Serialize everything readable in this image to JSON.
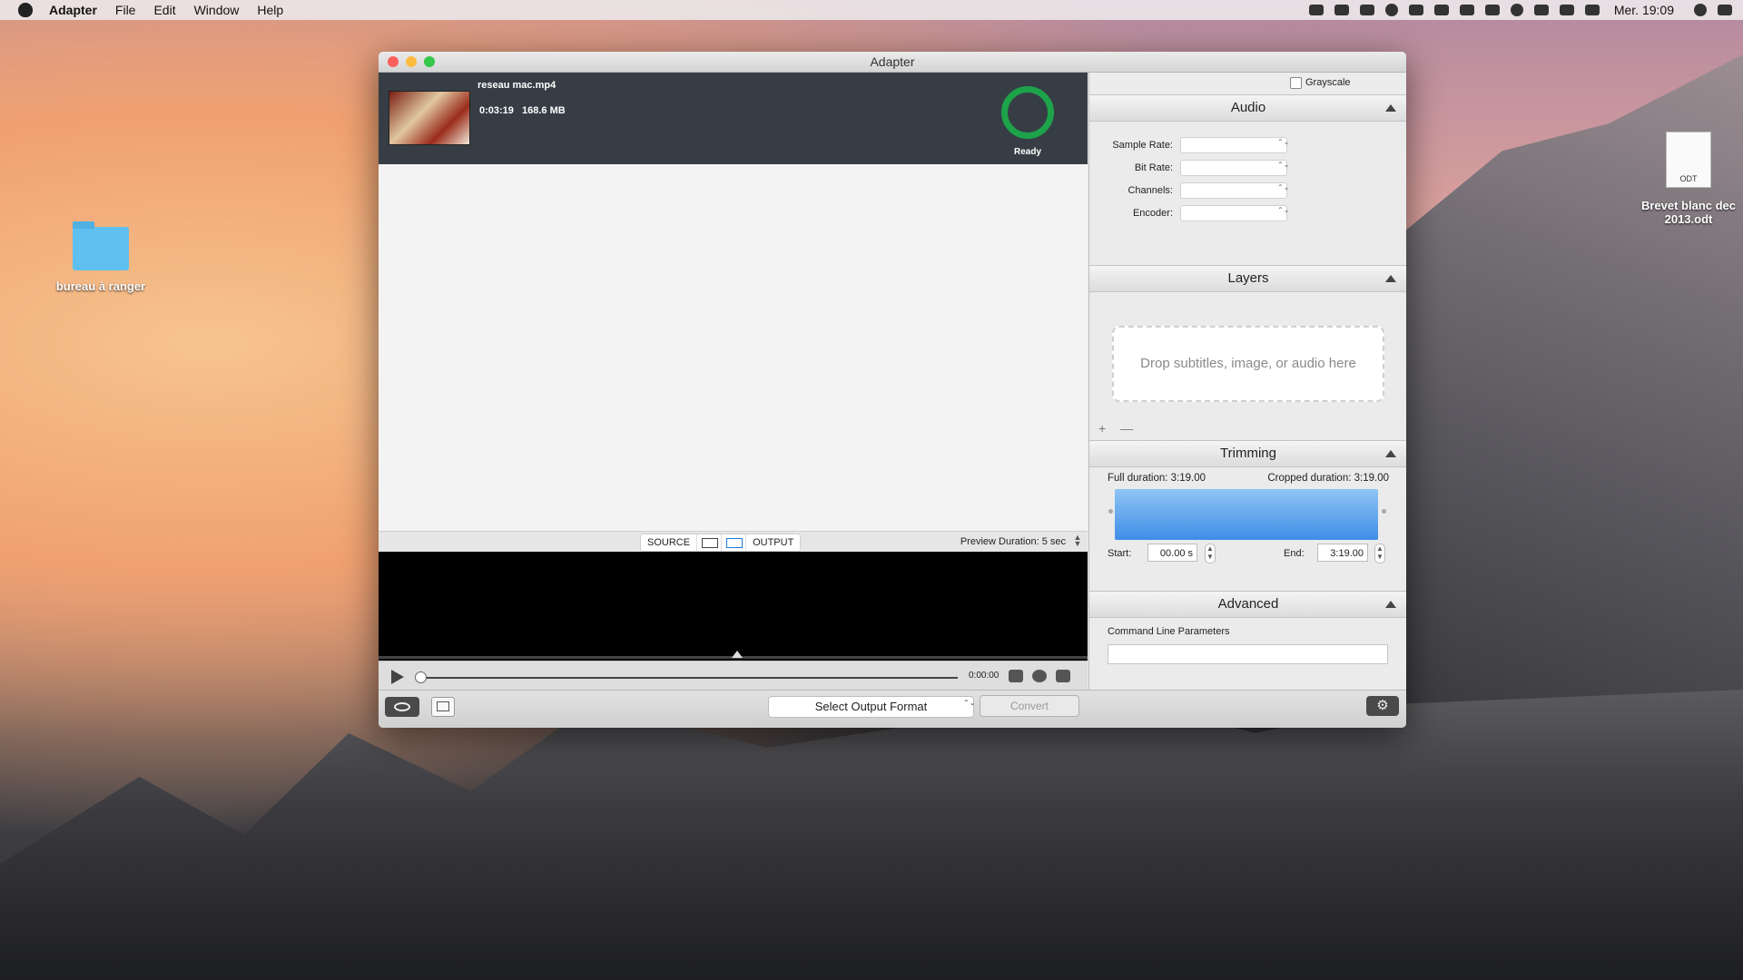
{
  "menubar": {
    "app": "Adapter",
    "items": [
      "File",
      "Edit",
      "Window",
      "Help"
    ],
    "clock": "Mer. 19:09"
  },
  "desktop": {
    "folder_label": "bureau à ranger",
    "doc_label": "Brevet blanc dec 2013.odt",
    "doc_badge": "ODT"
  },
  "window": {
    "title": "Adapter",
    "file": {
      "name": "reseau mac.mp4",
      "duration": "0:03:19",
      "size": "168.6 MB",
      "status": "Ready"
    },
    "view_bar": {
      "source": "SOURCE",
      "output": "OUTPUT",
      "preview_duration": "Preview Duration:  5 sec"
    },
    "player": {
      "time": "0:00:00"
    },
    "right": {
      "grayscale": "Grayscale",
      "audio": {
        "title": "Audio",
        "fields": [
          "Sample Rate:",
          "Bit Rate:",
          "Channels:",
          "Encoder:"
        ]
      },
      "layers": {
        "title": "Layers",
        "drop": "Drop subtitles, image, or audio here",
        "add": "+",
        "remove": "—"
      },
      "trimming": {
        "title": "Trimming",
        "full": "Full duration: 3:19.00",
        "cropped": "Cropped duration: 3:19.00",
        "start_label": "Start:",
        "start_value": "00.00 s",
        "end_label": "End:",
        "end_value": "3:19.00"
      },
      "advanced": {
        "title": "Advanced",
        "clp": "Command Line Parameters"
      }
    },
    "bottom": {
      "format": "Select Output Format",
      "convert": "Convert",
      "gear": "⚙"
    }
  }
}
